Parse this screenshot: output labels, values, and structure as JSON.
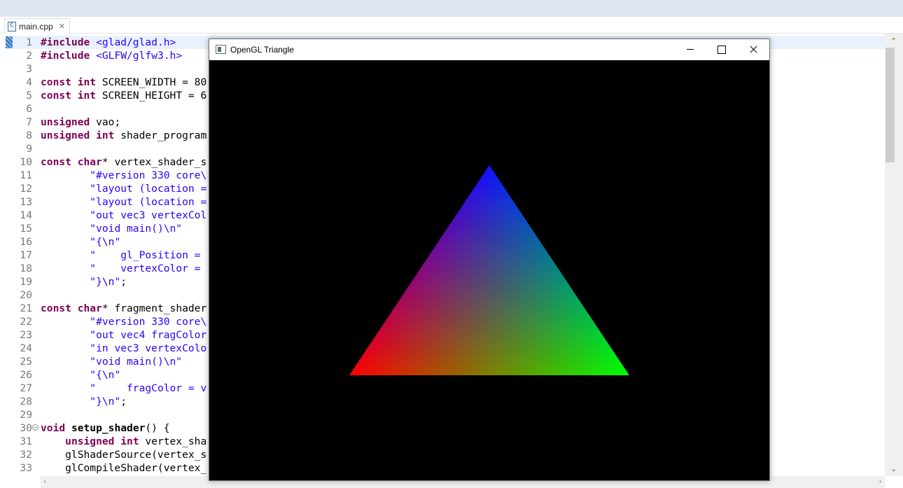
{
  "editor": {
    "tab_title": "main.cpp",
    "tab_close_glyph": "✕",
    "lines": [
      {
        "n": "1",
        "tokens": [
          [
            "kw",
            "#include"
          ],
          [
            "",
            " "
          ],
          [
            "str",
            "<glad/glad.h>"
          ]
        ],
        "current": true
      },
      {
        "n": "2",
        "tokens": [
          [
            "kw",
            "#include"
          ],
          [
            "",
            " "
          ],
          [
            "str",
            "<GLFW/glfw3.h>"
          ]
        ]
      },
      {
        "n": "3",
        "tokens": []
      },
      {
        "n": "4",
        "tokens": [
          [
            "kw",
            "const"
          ],
          [
            "",
            " "
          ],
          [
            "kw",
            "int"
          ],
          [
            "",
            " SCREEN_WIDTH = 80"
          ]
        ]
      },
      {
        "n": "5",
        "tokens": [
          [
            "kw",
            "const"
          ],
          [
            "",
            " "
          ],
          [
            "kw",
            "int"
          ],
          [
            "",
            " SCREEN_HEIGHT = 6"
          ]
        ]
      },
      {
        "n": "6",
        "tokens": []
      },
      {
        "n": "7",
        "tokens": [
          [
            "kw",
            "unsigned"
          ],
          [
            "",
            " vao;"
          ]
        ]
      },
      {
        "n": "8",
        "tokens": [
          [
            "kw",
            "unsigned"
          ],
          [
            "",
            " "
          ],
          [
            "kw",
            "int"
          ],
          [
            "",
            " shader_program"
          ]
        ]
      },
      {
        "n": "9",
        "tokens": []
      },
      {
        "n": "10",
        "tokens": [
          [
            "kw",
            "const"
          ],
          [
            "",
            " "
          ],
          [
            "kw",
            "char"
          ],
          [
            "",
            "* vertex_shader_s"
          ]
        ]
      },
      {
        "n": "11",
        "tokens": [
          [
            "",
            "        "
          ],
          [
            "str",
            "\"#version 330 core\\"
          ]
        ]
      },
      {
        "n": "12",
        "tokens": [
          [
            "",
            "        "
          ],
          [
            "str",
            "\"layout (location ="
          ]
        ]
      },
      {
        "n": "13",
        "tokens": [
          [
            "",
            "        "
          ],
          [
            "str",
            "\"layout (location ="
          ]
        ]
      },
      {
        "n": "14",
        "tokens": [
          [
            "",
            "        "
          ],
          [
            "str",
            "\"out vec3 vertexCol"
          ]
        ]
      },
      {
        "n": "15",
        "tokens": [
          [
            "",
            "        "
          ],
          [
            "str",
            "\"void main()\\n\""
          ]
        ]
      },
      {
        "n": "16",
        "tokens": [
          [
            "",
            "        "
          ],
          [
            "str",
            "\"{\\n\""
          ]
        ]
      },
      {
        "n": "17",
        "tokens": [
          [
            "",
            "        "
          ],
          [
            "str",
            "\"    gl_Position ="
          ]
        ]
      },
      {
        "n": "18",
        "tokens": [
          [
            "",
            "        "
          ],
          [
            "str",
            "\"    vertexColor ="
          ]
        ]
      },
      {
        "n": "19",
        "tokens": [
          [
            "",
            "        "
          ],
          [
            "str",
            "\"}\\n\""
          ],
          [
            "",
            ";"
          ]
        ]
      },
      {
        "n": "20",
        "tokens": []
      },
      {
        "n": "21",
        "tokens": [
          [
            "kw",
            "const"
          ],
          [
            "",
            " "
          ],
          [
            "kw",
            "char"
          ],
          [
            "",
            "* fragment_shader"
          ]
        ]
      },
      {
        "n": "22",
        "tokens": [
          [
            "",
            "        "
          ],
          [
            "str",
            "\"#version 330 core\\"
          ]
        ]
      },
      {
        "n": "23",
        "tokens": [
          [
            "",
            "        "
          ],
          [
            "str",
            "\"out vec4 fragColor"
          ]
        ]
      },
      {
        "n": "24",
        "tokens": [
          [
            "",
            "        "
          ],
          [
            "str",
            "\"in vec3 vertexColo"
          ]
        ]
      },
      {
        "n": "25",
        "tokens": [
          [
            "",
            "        "
          ],
          [
            "str",
            "\"void main()\\n\""
          ]
        ]
      },
      {
        "n": "26",
        "tokens": [
          [
            "",
            "        "
          ],
          [
            "str",
            "\"{\\n\""
          ]
        ]
      },
      {
        "n": "27",
        "tokens": [
          [
            "",
            "        "
          ],
          [
            "str",
            "\"     fragColor = v"
          ]
        ]
      },
      {
        "n": "28",
        "tokens": [
          [
            "",
            "        "
          ],
          [
            "str",
            "\"}\\n\""
          ],
          [
            "",
            ";"
          ]
        ]
      },
      {
        "n": "29",
        "tokens": []
      },
      {
        "n": "30",
        "fold": "−",
        "tokens": [
          [
            "kw",
            "void"
          ],
          [
            "",
            " "
          ],
          [
            "fn",
            "setup_shader"
          ],
          [
            "",
            "() {"
          ]
        ]
      },
      {
        "n": "31",
        "tokens": [
          [
            "",
            "    "
          ],
          [
            "kw",
            "unsigned"
          ],
          [
            "",
            " "
          ],
          [
            "kw",
            "int"
          ],
          [
            "",
            " vertex_sha"
          ]
        ]
      },
      {
        "n": "32",
        "tokens": [
          [
            "",
            "    glShaderSource(vertex_s"
          ]
        ]
      },
      {
        "n": "33",
        "tokens": [
          [
            "",
            "    glCompileShader(vertex_"
          ]
        ]
      }
    ]
  },
  "gl_window": {
    "title": "OpenGL Triangle",
    "background": "#000000",
    "triangle": {
      "top_color": "#0000ff",
      "left_color": "#ff0000",
      "right_color": "#00ff00"
    }
  },
  "colors": {
    "keyword": "#7f0055",
    "string": "#2a00ff",
    "line_number": "#787878",
    "current_line": "#e8f2fe"
  }
}
